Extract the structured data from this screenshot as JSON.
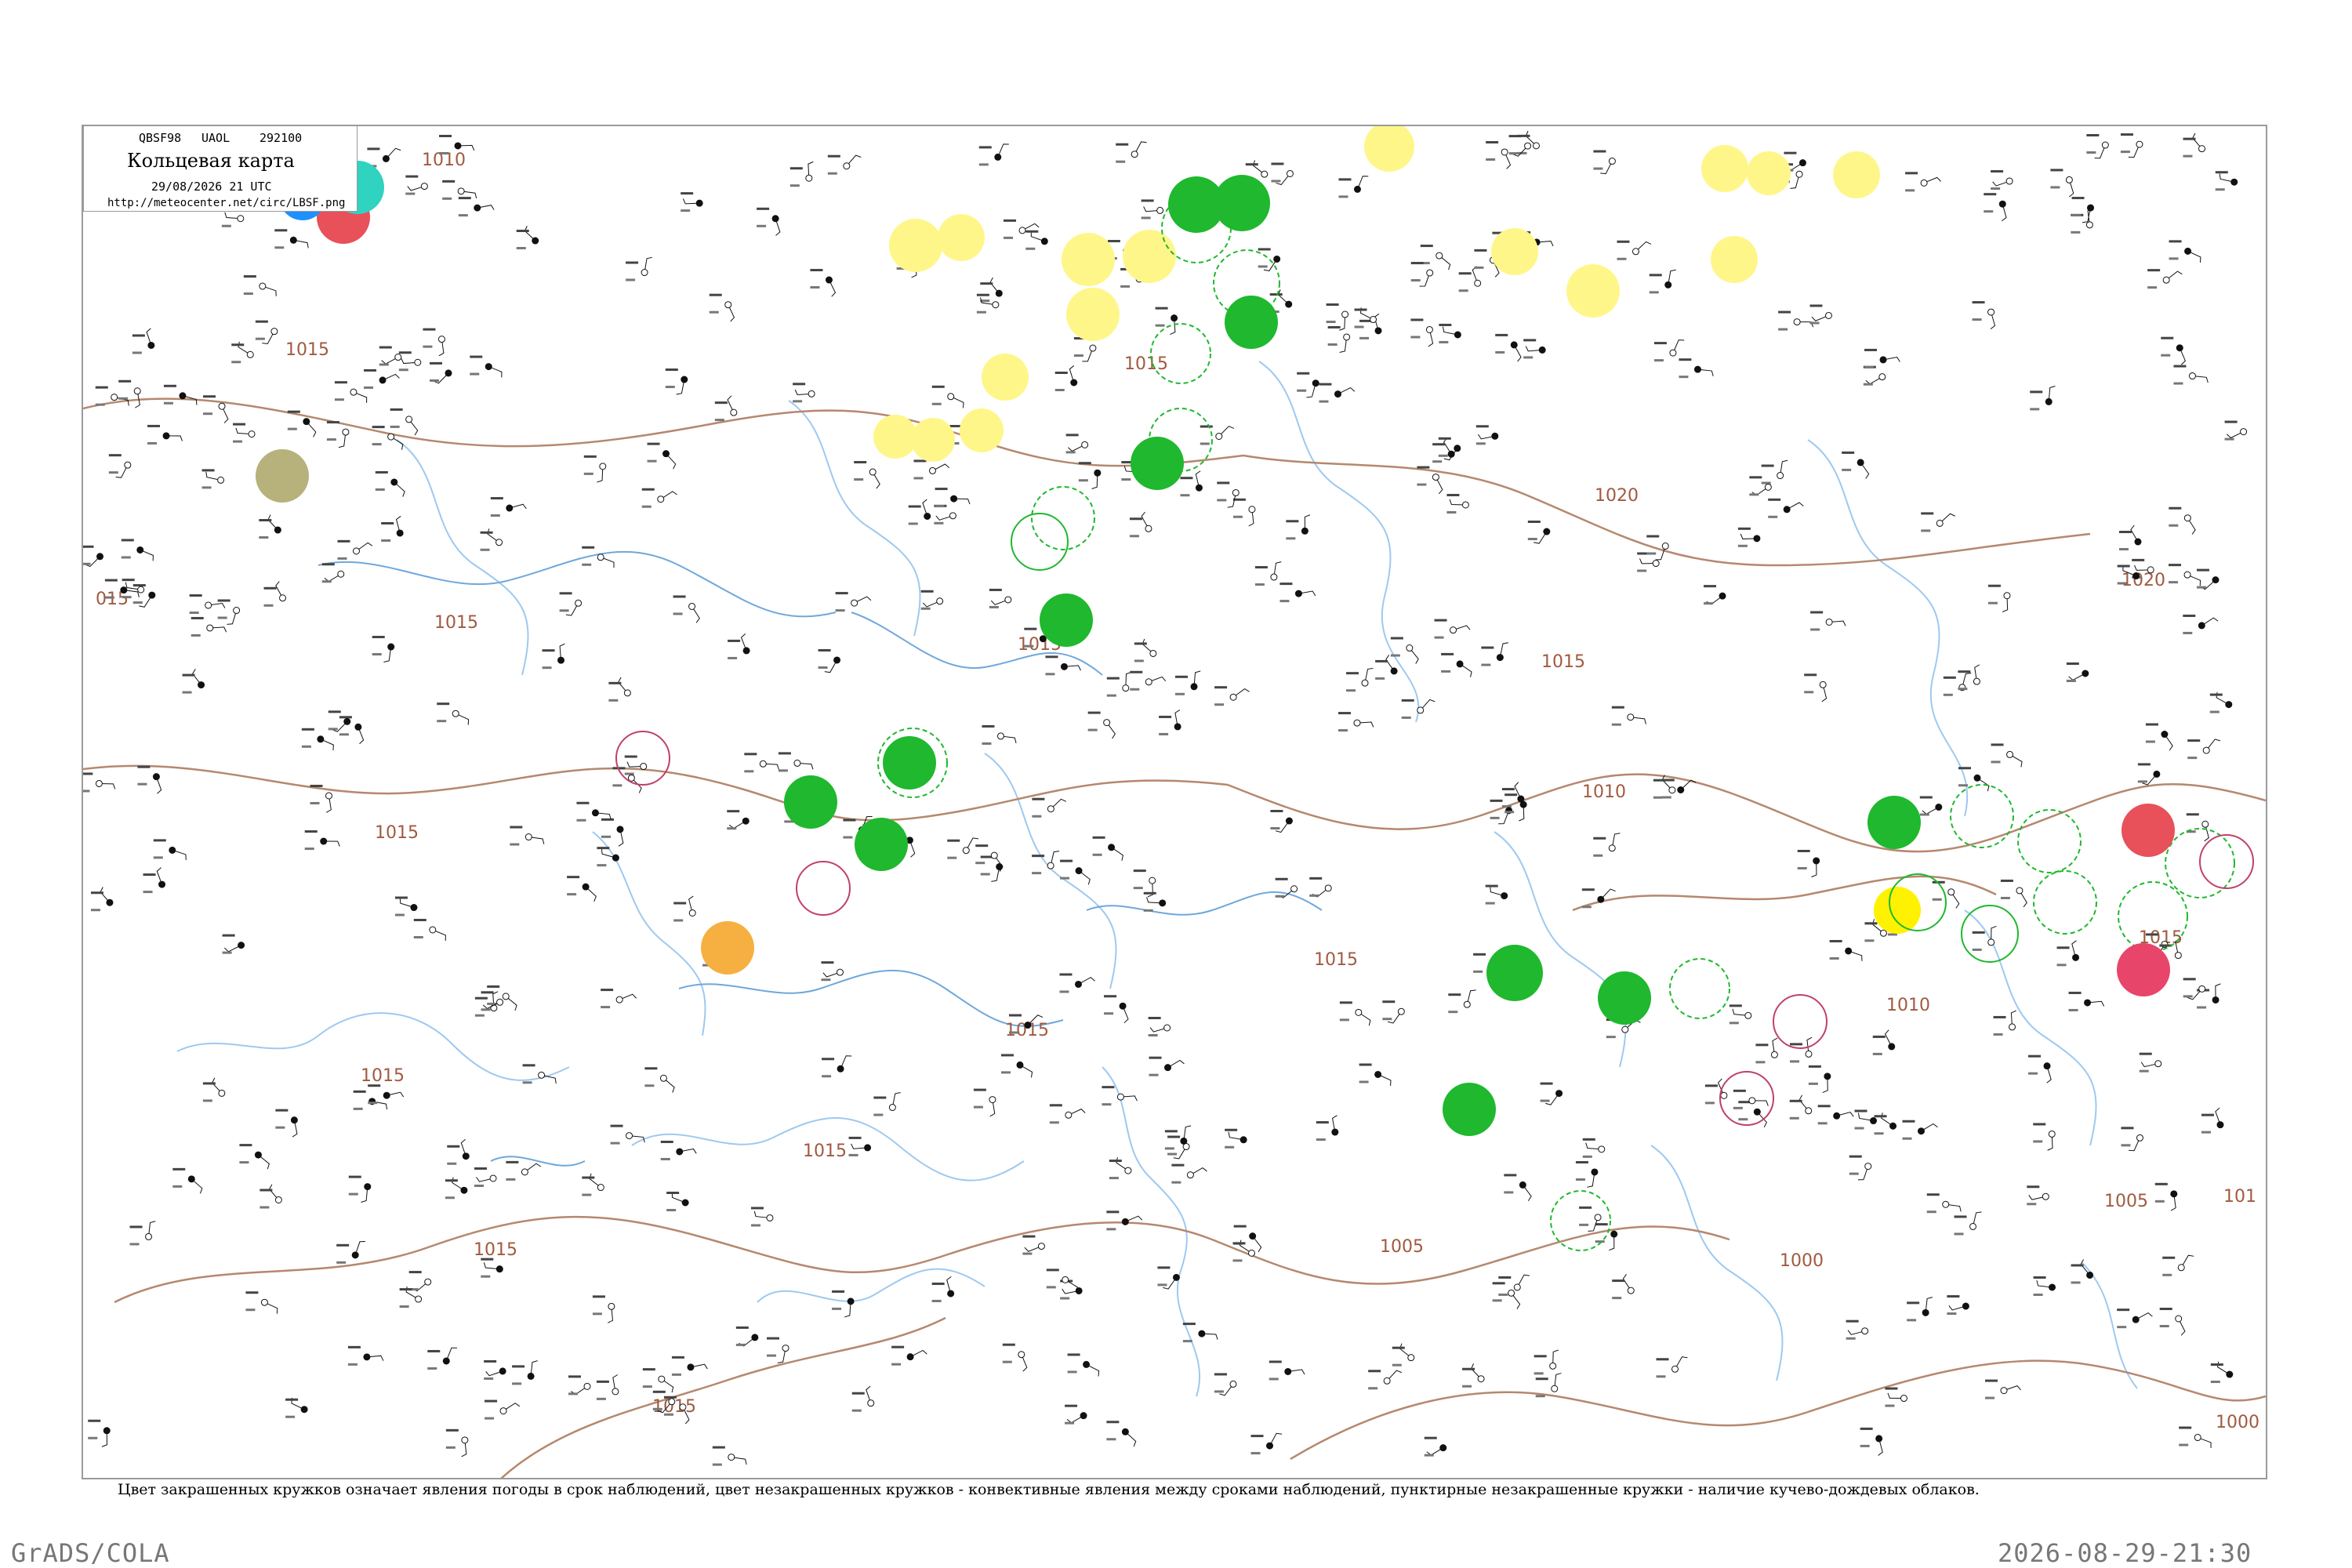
{
  "legend": {
    "codes": [
      "QBSF98",
      "UAOL",
      "292100"
    ],
    "title": "Кольцевая карта",
    "time": "29/08/2026 21 UTC",
    "url": "http://meteocenter.net/circ/LBSF.png"
  },
  "isobar_labels": {
    "l1010a": "1010",
    "l1015a": "1015",
    "l1015b": "1015",
    "l1015c": "1015",
    "l1015d": "1015",
    "l1015e": "1015",
    "l1015f": "1015",
    "l1015g": "1015",
    "l1015h": "1015",
    "l1015i": "1015",
    "l1015j": "1015",
    "l1015k": "1015",
    "l1010b": "1010",
    "l1010c": "1010",
    "l1015l": "1015",
    "l1020": "1020",
    "l1020b": "1020",
    "l1005a": "1005",
    "l1005b": "1005",
    "l1000a": "1000",
    "l1000b": "1000",
    "l101": "101",
    "l1015m": "1015",
    "l015": "015"
  },
  "caption": "Цвет закрашенных кружков означает явления погоды в срок наблюдений, цвет незакрашенных кружков - конвективные явления между сроками наблюдений, пунктирные незакрашенные кружки - наличие кучево-дождевых облаков.",
  "footer": {
    "left": "GrADS/COLA",
    "right": "2026-08-29-21:30"
  },
  "colors": {
    "isobar": "#b5886e",
    "river": "#9ec9f0",
    "coast": "#6fa8dc",
    "thunder_green": "#1fb82e",
    "rain_yellow": "#fff68a",
    "red": "#e8505a",
    "orange": "#f5b041",
    "olive": "#b7b27c"
  }
}
